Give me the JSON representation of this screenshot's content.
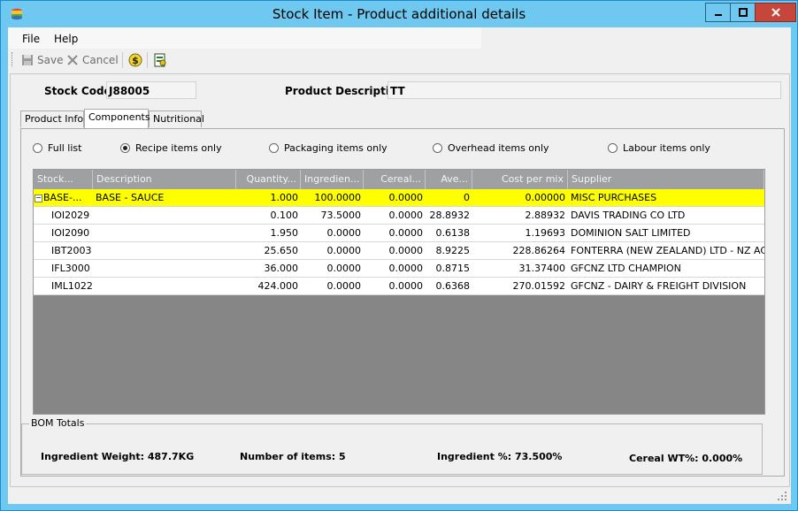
{
  "window": {
    "title": "Stock Item - Product additional details"
  },
  "menu": {
    "file": "File",
    "help": "Help"
  },
  "toolbar": {
    "save_label": "Save",
    "cancel_label": "Cancel"
  },
  "header": {
    "stock_code_label": "Stock Code",
    "stock_code_value": "J88005",
    "product_description_label": "Product Description",
    "product_description_value": "TT"
  },
  "tabs": [
    {
      "label": "Product Info"
    },
    {
      "label": "Components"
    },
    {
      "label": "Nutritional"
    }
  ],
  "filters": [
    {
      "label": "Full list",
      "selected": false
    },
    {
      "label": "Recipe items only",
      "selected": true
    },
    {
      "label": "Packaging items only",
      "selected": false
    },
    {
      "label": "Overhead items only",
      "selected": false
    },
    {
      "label": "Labour items only",
      "selected": false
    }
  ],
  "grid": {
    "columns": [
      "Stock...",
      "Description",
      "Quantity...",
      "Ingredien...",
      "Cereal...",
      "Ave...",
      "Cost per mix",
      "Supplier"
    ],
    "rows": [
      {
        "code": "BASE-...",
        "description": "BASE - SAUCE",
        "quantity": "1.000",
        "ingredient": "100.0000",
        "cereal": "0.0000",
        "ave": "0",
        "cost": "0.00000",
        "supplier": "MISC PURCHASES",
        "highlight": true
      },
      {
        "code": "IOI2029",
        "description": "",
        "quantity": "0.100",
        "ingredient": "73.5000",
        "cereal": "0.0000",
        "ave": "28.8932",
        "cost": "2.88932",
        "supplier": "DAVIS TRADING CO LTD"
      },
      {
        "code": "IOI2090",
        "description": "",
        "quantity": "1.950",
        "ingredient": "0.0000",
        "cereal": "0.0000",
        "ave": "0.6138",
        "cost": "1.19693",
        "supplier": "DOMINION SALT LIMITED"
      },
      {
        "code": "IBT2003",
        "description": "",
        "quantity": "25.650",
        "ingredient": "0.0000",
        "cereal": "0.0000",
        "ave": "8.9225",
        "cost": "228.86264",
        "supplier": "FONTERRA (NEW ZEALAND) LTD - NZ ACC"
      },
      {
        "code": "IFL3000",
        "description": "",
        "quantity": "36.000",
        "ingredient": "0.0000",
        "cereal": "0.0000",
        "ave": "0.8715",
        "cost": "31.37400",
        "supplier": "GFCNZ LTD CHAMPION"
      },
      {
        "code": "IML1022",
        "description": "",
        "quantity": "424.000",
        "ingredient": "0.0000",
        "cereal": "0.0000",
        "ave": "0.6368",
        "cost": "270.01592",
        "supplier": "GFCNZ - DAIRY & FREIGHT DIVISION"
      }
    ]
  },
  "bom_totals": {
    "title": "BOM Totals",
    "ingredient_weight": "Ingredient Weight: 487.7KG",
    "number_of_items": "Number of items: 5",
    "ingredient_pct": "Ingredient %: 73.500%",
    "cereal_pct": "Cereal WT%: 0.000%"
  },
  "colors": {
    "titlebar": "#6fc8ef",
    "highlight_row": "#ffff00",
    "grid_empty": "#868686",
    "grid_header": "#9ea0a2",
    "close_button": "#c7463c"
  }
}
